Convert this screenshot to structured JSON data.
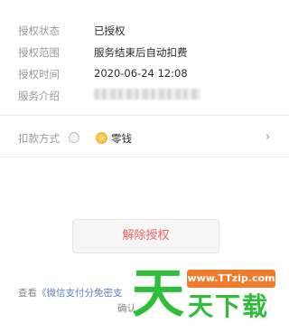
{
  "details": [
    {
      "label": "授权状态",
      "value": "已授权"
    },
    {
      "label": "授权范围",
      "value": "服务结束后自动扣费"
    },
    {
      "label": "授权时间",
      "value": "2020-06-24 12:08"
    },
    {
      "label": "服务介绍",
      "value": ""
    }
  ],
  "payment": {
    "label": "扣款方式",
    "info_icon": "ⓘ",
    "method": "零钱",
    "method_icon": "coin-icon",
    "chevron": "›"
  },
  "action": {
    "revoke_label": "解除授权",
    "revoke_color": "#f2635f"
  },
  "footer": {
    "prefix": "查看",
    "link": "《微信支付分免密支",
    "line2": "确认"
  },
  "watermark": {
    "big_char": "天",
    "url": "www.TTzip.com",
    "text": "天下载",
    "color": "#2fbd3a",
    "badge_color": "#f07c2b"
  }
}
